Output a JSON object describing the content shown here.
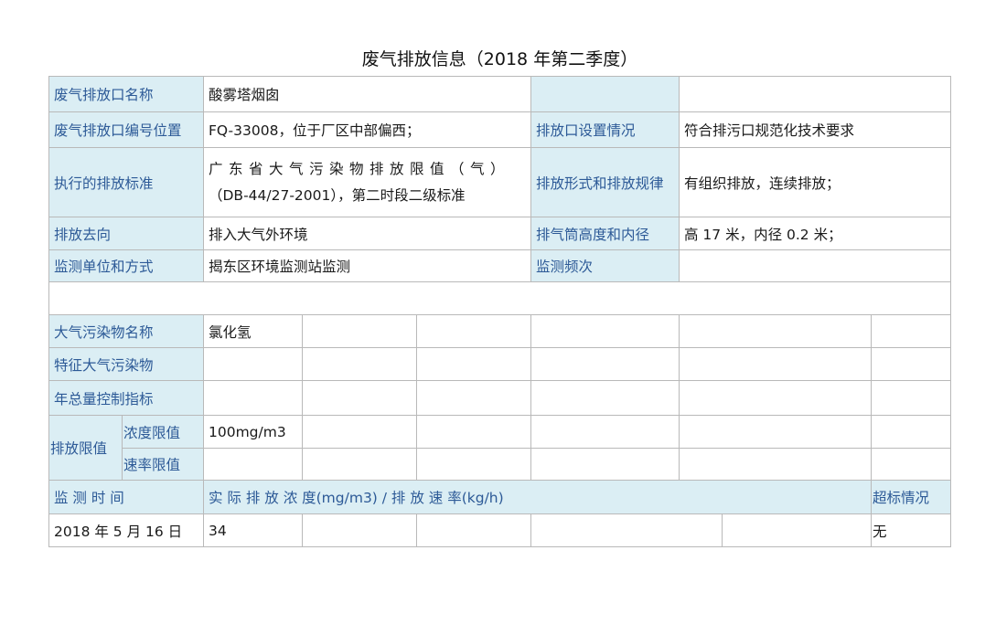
{
  "title": "废气排放信息（2018 年第二季度）",
  "outlet": {
    "name_label": "废气排放口名称",
    "name_value": "酸雾塔烟囱",
    "code_label": "废气排放口编号位置",
    "code_value": "FQ-33008，位于厂区中部偏西；",
    "setting_label": "排放口设置情况",
    "setting_value": "符合排污口规范化技术要求",
    "standard_label": "执行的排放标准",
    "standard_line1": "广东省大气污染物排放限值（气）",
    "standard_line2": "（DB-44/27-2001），第二时段二级标准",
    "form_label": "排放形式和排放规律",
    "form_value": "有组织排放，连续排放；",
    "direction_label": "排放去向",
    "direction_value": "排入大气外环境",
    "stack_label": "排气筒高度和内径",
    "stack_value": "高 17 米，内径 0.2 米；",
    "monitor_label": "监测单位和方式",
    "monitor_value": "揭东区环境监测站监测",
    "frequency_label": "监测频次",
    "frequency_value": ""
  },
  "pollutants": {
    "name_label": "大气污染物名称",
    "name_value": "氯化氢",
    "feature_label": "特征大气污染物",
    "total_label": "年总量控制指标",
    "limit_label": "排放限值",
    "conc_label": "浓度限值",
    "conc_value": "100mg/m3",
    "rate_label": "速率限值"
  },
  "records_header": {
    "time_label": "监 测 时 间",
    "actual_label": "实 际 排 放 浓 度(mg/m3) / 排 放 速 率(kg/h)",
    "exceed_label": "超标情况"
  },
  "records": [
    {
      "date": "2018 年 5 月 16 日",
      "value": "34",
      "exceed": "无"
    }
  ]
}
